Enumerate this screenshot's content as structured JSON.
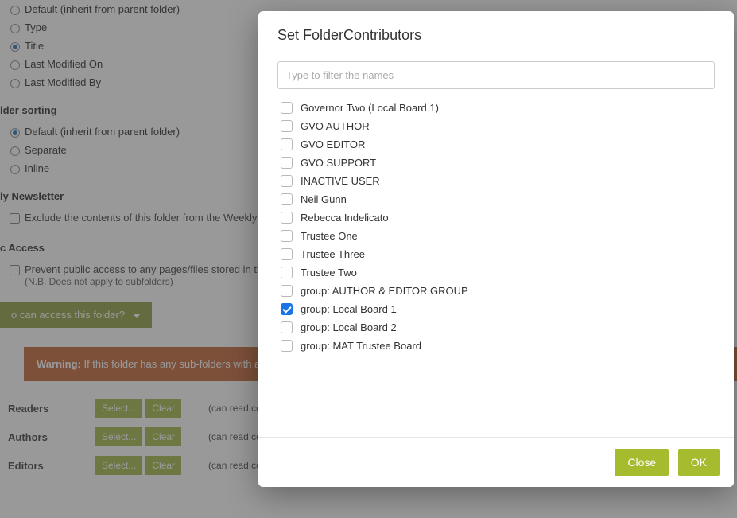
{
  "bg": {
    "sort_options": [
      {
        "label": "Default (inherit from parent folder)",
        "checked": false
      },
      {
        "label": "Type",
        "checked": false
      },
      {
        "label": "Title",
        "checked": true
      },
      {
        "label": "Last Modified On",
        "checked": false
      },
      {
        "label": "Last Modified By",
        "checked": false
      }
    ],
    "folder_sorting_header": "lder sorting",
    "folder_sorting": [
      {
        "label": "Default (inherit from parent folder)",
        "checked": true
      },
      {
        "label": "Separate",
        "checked": false
      },
      {
        "label": "Inline",
        "checked": false
      }
    ],
    "newsletter_header": "ly Newsletter",
    "newsletter_option": "Exclude the contents of this folder from the Weekly Newsle",
    "public_access_header": "c Access",
    "public_access_line1": "Prevent public access to any pages/files stored in this fold",
    "public_access_line2": "(N.B. Does not apply to subfolders)",
    "access_button": "o can access this folder?",
    "warning_bold": "Warning:",
    "warning_text": " If this folder has any sub-folders with access",
    "roles": [
      {
        "name": "Readers",
        "desc": "(can read conte"
      },
      {
        "name": "Authors",
        "desc": "(can read content "
      },
      {
        "name": "Editors",
        "desc": "(can read content, add new content and edit existing content)"
      }
    ],
    "select_btn": "Select...",
    "clear_btn": "Clear"
  },
  "modal": {
    "title": "Set FolderContributors",
    "filter_placeholder": "Type to filter the names",
    "items": [
      {
        "label": "Governor Two (Local Board 1)",
        "checked": false
      },
      {
        "label": "GVO AUTHOR",
        "checked": false
      },
      {
        "label": "GVO EDITOR",
        "checked": false
      },
      {
        "label": "GVO SUPPORT",
        "checked": false
      },
      {
        "label": "INACTIVE USER",
        "checked": false
      },
      {
        "label": "Neil Gunn",
        "checked": false
      },
      {
        "label": "Rebecca Indelicato",
        "checked": false
      },
      {
        "label": "Trustee One",
        "checked": false
      },
      {
        "label": "Trustee Three",
        "checked": false
      },
      {
        "label": "Trustee Two",
        "checked": false
      },
      {
        "label": "group: AUTHOR & EDITOR GROUP",
        "checked": false
      },
      {
        "label": "group: Local Board 1",
        "checked": true
      },
      {
        "label": "group: Local Board 2",
        "checked": false
      },
      {
        "label": "group: MAT Trustee Board",
        "checked": false
      }
    ],
    "close_btn": "Close",
    "ok_btn": "OK"
  }
}
